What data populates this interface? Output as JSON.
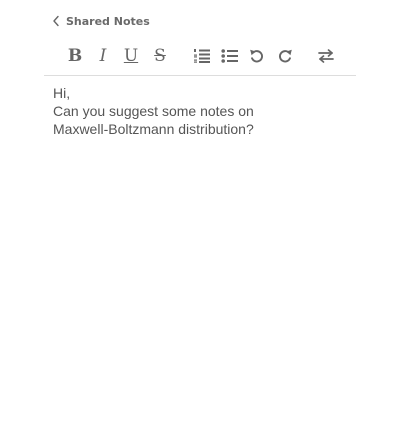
{
  "header": {
    "title": "Shared Notes"
  },
  "toolbar": {
    "bold_label": "B",
    "italic_label": "I",
    "underline_label": "U",
    "strike_label": "S",
    "icons": [
      "ordered-list-icon",
      "unordered-list-icon",
      "undo-icon",
      "redo-icon",
      "swap-icon"
    ]
  },
  "editor": {
    "lines": [
      "Hi,",
      "Can you suggest some notes on",
      "Maxwell-Boltzmann distribution?"
    ]
  }
}
